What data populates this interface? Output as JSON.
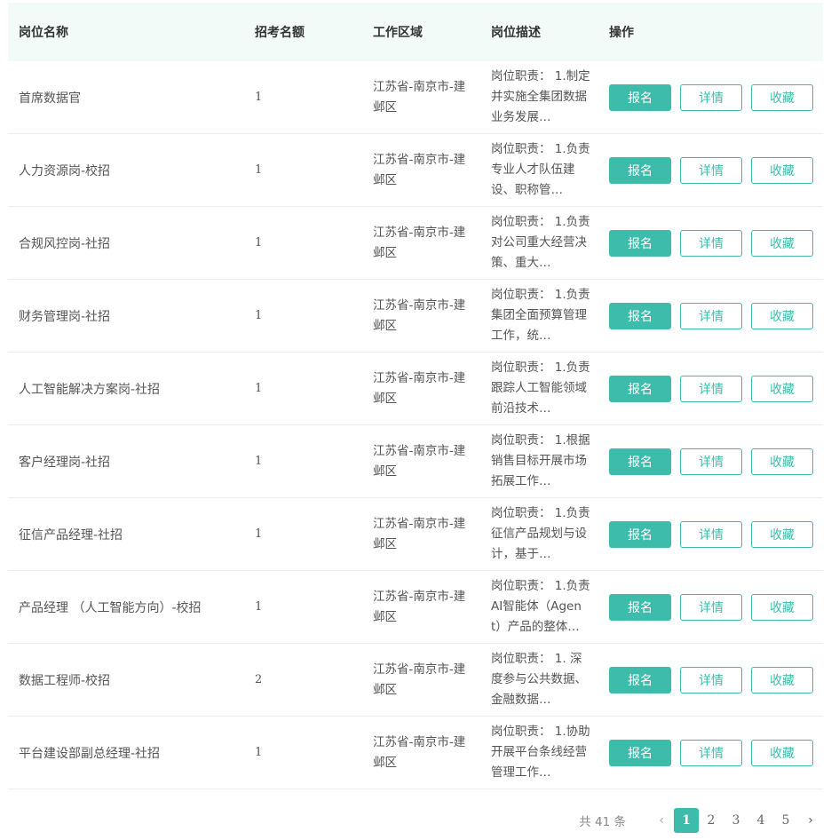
{
  "headers": {
    "name": "岗位名称",
    "quota": "招考名额",
    "area": "工作区域",
    "desc": "岗位描述",
    "ops": "操作"
  },
  "buttons": {
    "apply": "报名",
    "detail": "详情",
    "favorite": "收藏"
  },
  "rows": [
    {
      "name": "首席数据官",
      "quota": "1",
      "area": "江苏省-南京市-建邺区",
      "desc": "岗位职责： 1.制定并实施全集团数据业务发展…"
    },
    {
      "name": "人力资源岗-校招",
      "quota": "1",
      "area": "江苏省-南京市-建邺区",
      "desc": "岗位职责： 1.负责专业人才队伍建设、职称管…"
    },
    {
      "name": "合规风控岗-社招",
      "quota": "1",
      "area": "江苏省-南京市-建邺区",
      "desc": "岗位职责： 1.负责对公司重大经营决策、重大…"
    },
    {
      "name": "财务管理岗-社招",
      "quota": "1",
      "area": "江苏省-南京市-建邺区",
      "desc": "岗位职责： 1.负责集团全面预算管理工作，统…"
    },
    {
      "name": "人工智能解决方案岗-社招",
      "quota": "1",
      "area": "江苏省-南京市-建邺区",
      "desc": "岗位职责： 1.负责跟踪人工智能领域前沿技术…"
    },
    {
      "name": "客户经理岗-社招",
      "quota": "1",
      "area": "江苏省-南京市-建邺区",
      "desc": "岗位职责： 1.根据销售目标开展市场拓展工作…"
    },
    {
      "name": "征信产品经理-社招",
      "quota": "1",
      "area": "江苏省-南京市-建邺区",
      "desc": "岗位职责： 1.负责征信产品规划与设计，基于…"
    },
    {
      "name": "产品经理 （人工智能方向）-校招",
      "quota": "1",
      "area": "江苏省-南京市-建邺区",
      "desc": "岗位职责： 1.负责AI智能体（Agent）产品的整体…"
    },
    {
      "name": "数据工程师-校招",
      "quota": "2",
      "area": "江苏省-南京市-建邺区",
      "desc": "岗位职责： 1. 深度参与公共数据、金融数据…"
    },
    {
      "name": "平台建设部副总经理-社招",
      "quota": "1",
      "area": "江苏省-南京市-建邺区",
      "desc": "岗位职责： 1.协助开展平台条线经营管理工作…"
    }
  ],
  "pagination": {
    "total": "共 41 条",
    "prev": "‹",
    "next": "›",
    "pages": [
      "1",
      "2",
      "3",
      "4",
      "5"
    ],
    "current": "1"
  },
  "colors": {
    "accent": "#3dbcac",
    "header_bg": "#f3fbf9"
  }
}
